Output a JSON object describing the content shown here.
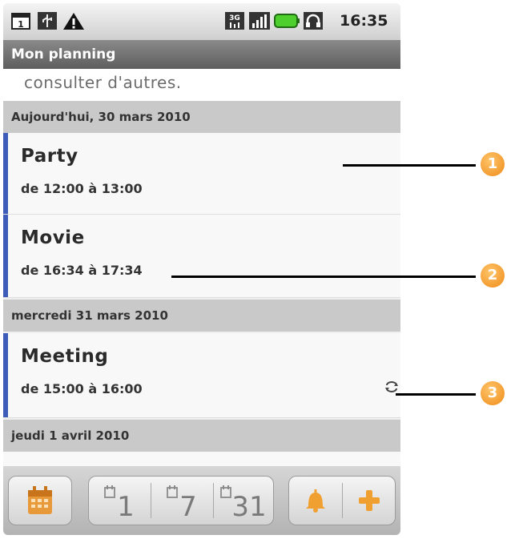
{
  "statusbar": {
    "left_icons": [
      "calendar-1-icon",
      "usb-icon",
      "warning-icon"
    ],
    "right_icons": [
      "3g-icon",
      "signal-icon",
      "battery-icon",
      "headset-icon"
    ],
    "time": "16:35"
  },
  "header": {
    "title": "Mon planning"
  },
  "notice": {
    "text": "consulter d'autres."
  },
  "days": [
    {
      "label": "Aujourd'hui, 30 mars 2010",
      "events": [
        {
          "title": "Party",
          "time": "de 12:00 à 13:00"
        },
        {
          "title": "Movie",
          "time": "de 16:34 à 17:34"
        }
      ]
    },
    {
      "label": "mercredi 31 mars 2010",
      "events": [
        {
          "title": "Meeting",
          "time": "de 15:00 à 16:00",
          "recurring": true
        }
      ]
    },
    {
      "label": "jeudi 1 avril 2010",
      "events": []
    }
  ],
  "toolbar": {
    "day_label": "1",
    "week_label": "7",
    "month_label": "31"
  },
  "callouts": [
    "1",
    "2",
    "3"
  ],
  "colors": {
    "event_bar": "#3d5bb8",
    "callout": "#ee8a18"
  }
}
